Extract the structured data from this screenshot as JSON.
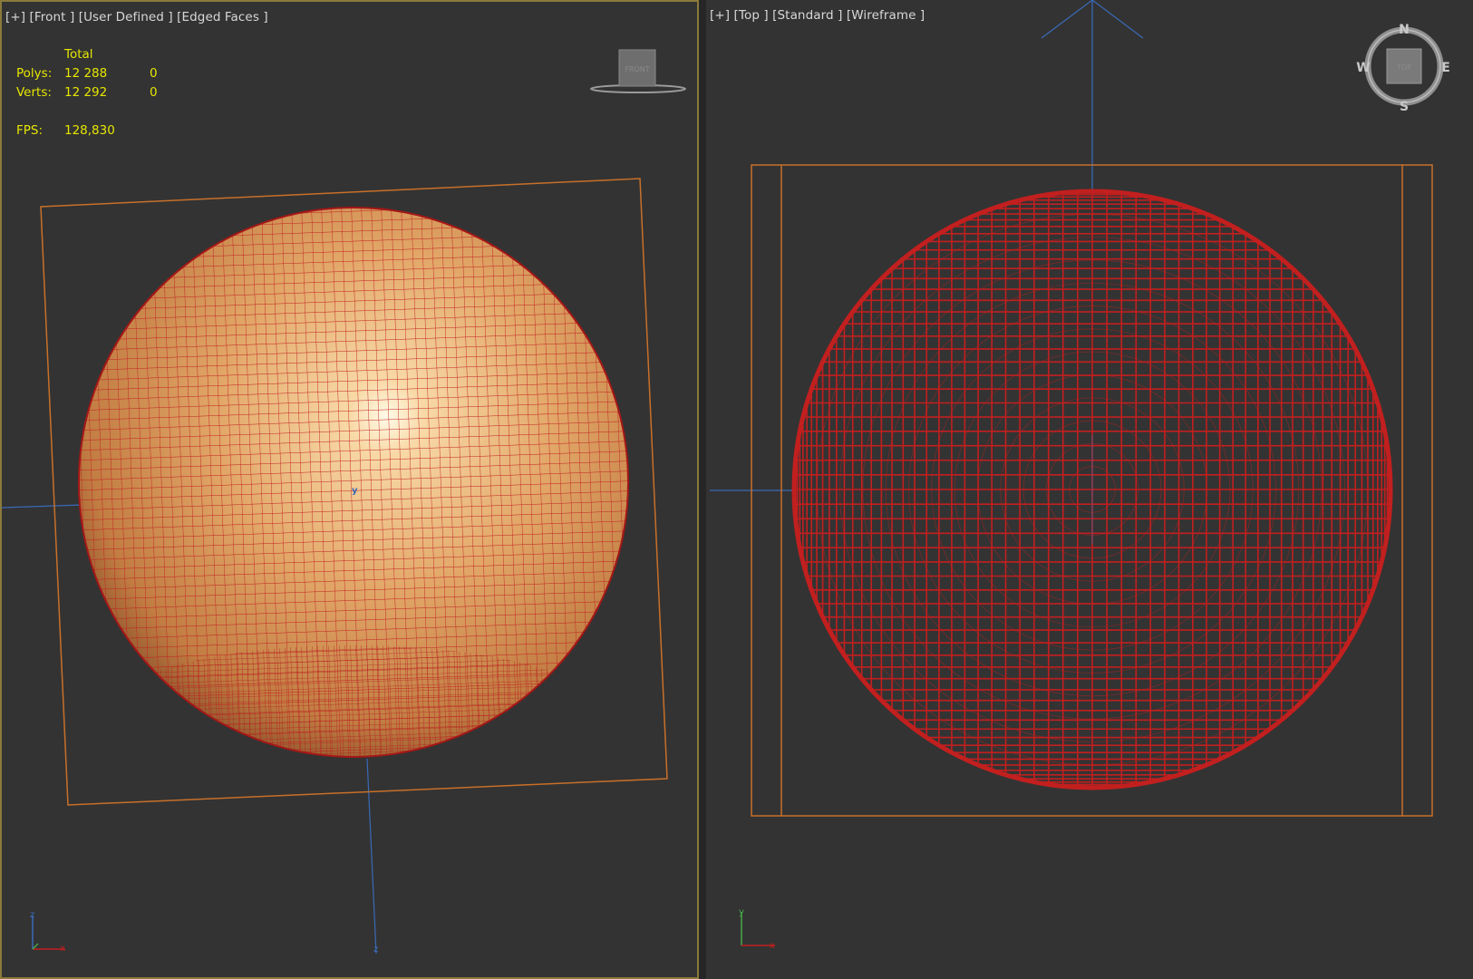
{
  "viewports": {
    "front": {
      "label": "[+] [Front ] [User Defined ] [Edged Faces ]",
      "stats": {
        "header": "Total",
        "polys_label": "Polys:",
        "polys_total": "12 288",
        "polys_selected": "0",
        "verts_label": "Verts:",
        "verts_total": "12 292",
        "verts_selected": "0",
        "fps_label": "FPS:",
        "fps_value": "128,830"
      },
      "viewcube_label": "FRONT",
      "gizmo_label": "y",
      "grid_axis_label": "z",
      "axis_tripod": {
        "vertical": "z",
        "horizontal": "x"
      }
    },
    "top": {
      "label": "[+] [Top ] [Standard ] [Wireframe ]",
      "viewcube_label": "TOP",
      "compass": {
        "n": "N",
        "s": "S",
        "e": "E",
        "w": "W"
      },
      "axis_tripod": {
        "vertical": "y",
        "horizontal": "x"
      }
    }
  },
  "colors": {
    "viewport_bg": "#333333",
    "active_border": "#8a7a3a",
    "stats_text": "#e6e600",
    "wire_red": "#c21f1f",
    "bbox_orange": "#c8702a",
    "axis_blue": "#3a6ab8"
  }
}
